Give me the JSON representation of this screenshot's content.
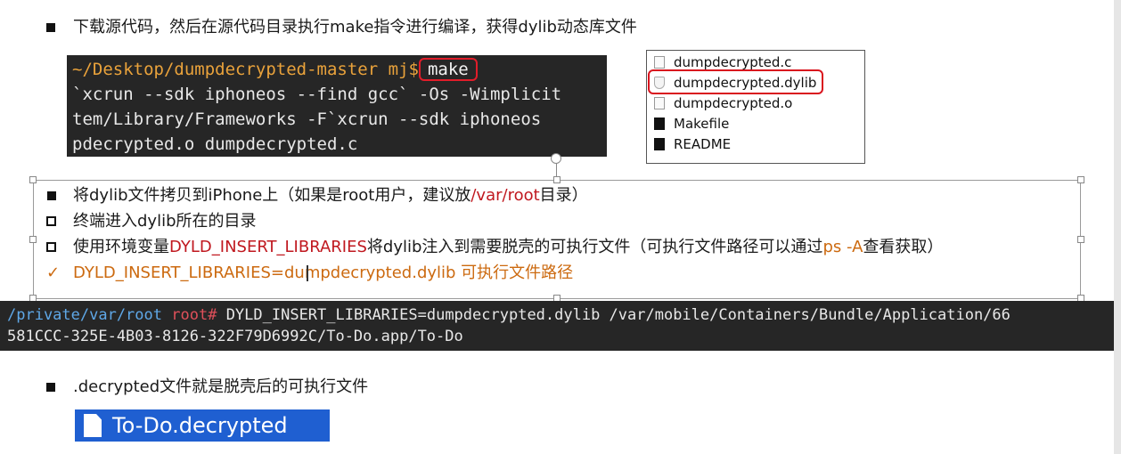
{
  "bullets": {
    "b1": "下载源代码，然后在源代码目录执行make指令进行编译，获得dylib动态库文件",
    "b2_pre": "将dylib文件拷贝到iPhone上（如果是root用户，建议放",
    "b2_path": "/var/root",
    "b2_post": "目录）",
    "b3": "终端进入dylib所在的目录",
    "b4_pre": "使用环境变量",
    "b4_env": "DYLD_INSERT_LIBRARIES",
    "b4_mid": "将dylib注入到需要脱壳的可执行文件（可执行文件路径可以通过",
    "b4_ps": "ps -A",
    "b4_post": "查看获取）",
    "b5_check": "✓",
    "b5_a": "DYLD_INSERT_LIBRARIES=",
    "b5_b": "dumpdecrypted.dylib   可执行文件路径",
    "b6": ".decrypted文件就是脱壳后的可执行文件"
  },
  "terminal1": {
    "path": "~/Desktop/dumpdecrypted-master",
    "user": "mj$",
    "command": "make",
    "line2": "`xcrun --sdk iphoneos --find gcc` -Os  -Wimplicit",
    "line3": "tem/Library/Frameworks -F`xcrun --sdk iphoneos",
    "line4": "pdecrypted.o dumpdecrypted.c"
  },
  "finder": {
    "items": [
      {
        "name": "dumpdecrypted.c",
        "icon": "c-source-icon"
      },
      {
        "name": "dumpdecrypted.dylib",
        "icon": "dylib-icon"
      },
      {
        "name": "dumpdecrypted.o",
        "icon": "object-file-icon"
      },
      {
        "name": "Makefile",
        "icon": "exec-file-icon"
      },
      {
        "name": "README",
        "icon": "exec-file-icon"
      }
    ]
  },
  "terminal2": {
    "path": "/private/var/root",
    "user": "root#",
    "line1": "DYLD_INSERT_LIBRARIES=dumpdecrypted.dylib /var/mobile/Containers/Bundle/Application/66",
    "line2": "581CCC-325E-4B03-8126-322F79D6992C/To-Do.app/To-Do"
  },
  "file_chip": {
    "name": "To-Do.decrypted",
    "color": "#1f5fd1"
  },
  "colors": {
    "red": "#c0181f",
    "orange": "#cc6a10",
    "terminal_bg": "#262626",
    "highlight_box": "#d9141e"
  }
}
